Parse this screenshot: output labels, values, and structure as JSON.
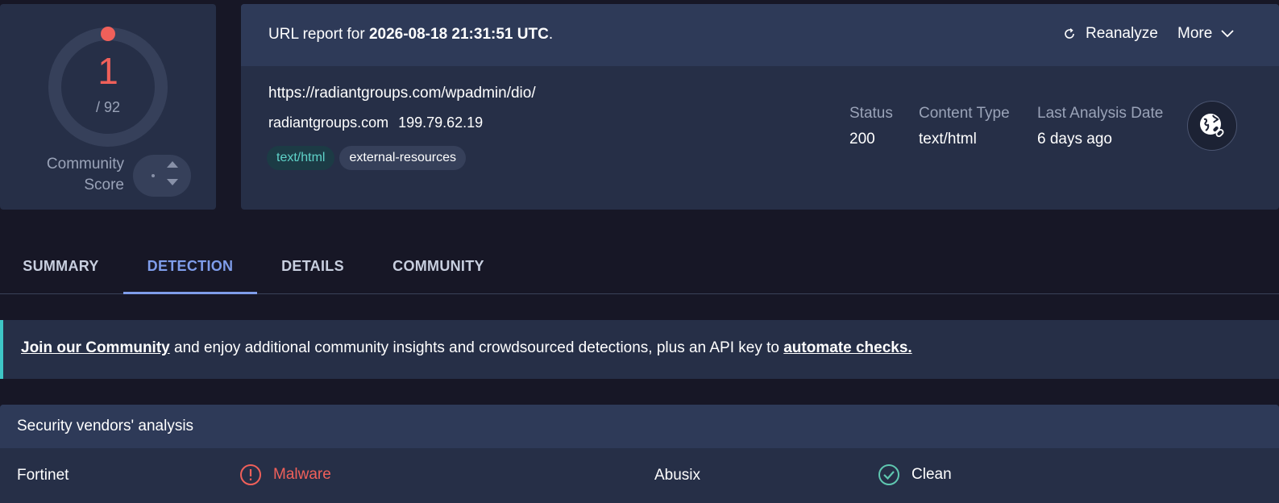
{
  "score": {
    "detections": "1",
    "total": "/ 92",
    "community_label_line1": "Community",
    "community_label_line2": "Score"
  },
  "report": {
    "title_prefix": "URL report for ",
    "timestamp": "2026-08-18 21:31:51 UTC",
    "title_suffix": ".",
    "reanalyze_label": "Reanalyze",
    "more_label": "More",
    "url": "https://radiantgroups.com/wpadmin/dio/",
    "domain": "radiantgroups.com",
    "ip": "199.79.62.19",
    "tags": [
      "text/html",
      "external-resources"
    ],
    "meta": [
      {
        "label": "Status",
        "value": "200"
      },
      {
        "label": "Content Type",
        "value": "text/html"
      },
      {
        "label": "Last Analysis Date",
        "value": "6 days ago"
      }
    ]
  },
  "tabs": [
    {
      "label": "SUMMARY",
      "active": false
    },
    {
      "label": "DETECTION",
      "active": true
    },
    {
      "label": "DETAILS",
      "active": false
    },
    {
      "label": "COMMUNITY",
      "active": false
    }
  ],
  "banner": {
    "join_link": "Join our Community",
    "middle_text": " and enjoy additional community insights and crowdsourced detections, plus an API key to ",
    "automate_link": "automate checks."
  },
  "vendors": {
    "title": "Security vendors' analysis",
    "rows": [
      {
        "vendor": "Fortinet",
        "result": "Malware",
        "status": "malicious"
      },
      {
        "vendor": "Abusix",
        "result": "Clean",
        "status": "clean"
      }
    ]
  },
  "colors": {
    "accent": "#7f9dea",
    "malicious": "#f0605a",
    "clean": "#5fc7b0",
    "banner_stripe": "#3ec6c6"
  }
}
